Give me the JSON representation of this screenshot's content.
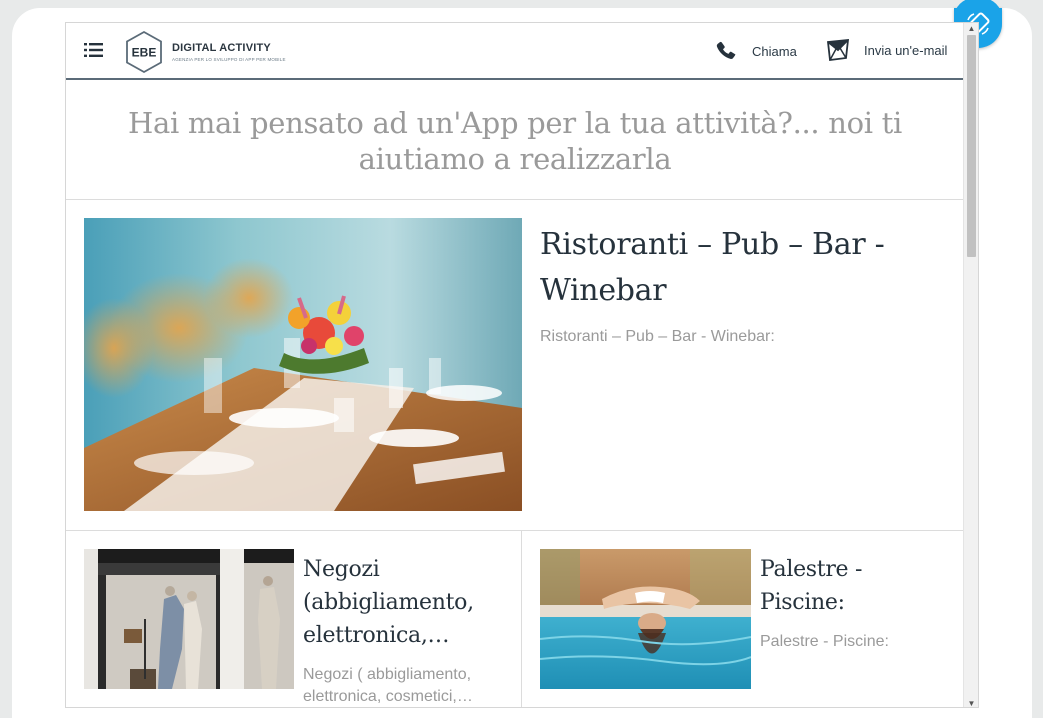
{
  "header": {
    "logo_mark": "EBE",
    "logo_title": "DIGITAL ACTIVITY",
    "logo_subtitle": "AGENZIA PER LO SVILUPPO DI APP PER MOBILE",
    "call_label": "Chiama",
    "email_label": "Invia un'e-mail"
  },
  "headline": "Hai mai pensato ad un'App per la tua attività?... noi ti aiutiamo a realizzarla",
  "cards": [
    {
      "title": "Ristoranti – Pub – Bar - Winebar",
      "description": "Ristoranti – Pub – Bar - Winebar:"
    },
    {
      "title": "Negozi (abbigliamento, elettronica,…",
      "description": "Negozi ( abbigliamento, elettronica, cosmetici,…"
    },
    {
      "title": "Palestre - Piscine:",
      "description": "Palestre - Piscine:"
    }
  ],
  "colors": {
    "accent": "#1aa3e8",
    "header_divider": "#5b6b78",
    "title_text": "#26323c",
    "muted_text": "#9a9a9a"
  },
  "icons": {
    "menu": "menu-icon",
    "phone": "phone-icon",
    "email": "envelope-icon",
    "rotate": "rotate-device-icon"
  }
}
